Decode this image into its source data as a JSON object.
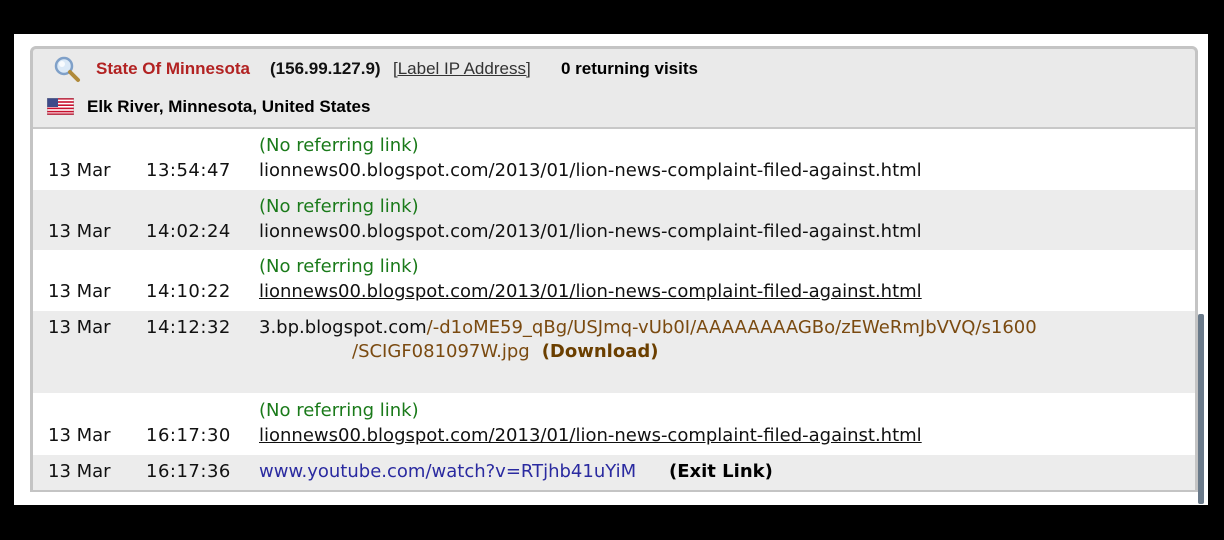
{
  "header": {
    "organization": "State Of Minnesota",
    "ip": "(156.99.127.9)",
    "label_ip": "[Label IP Address]",
    "returning": "0 returning visits",
    "location": "Elk River, Minnesota, United States"
  },
  "rows": [
    {
      "date": "13 Mar",
      "time": "13:54:47",
      "referrer": "(No referring link)",
      "url": "lionnews00.blogspot.com/2013/01/lion-news-complaint-filed-against.html"
    },
    {
      "date": "13 Mar",
      "time": "14:02:24",
      "referrer": "(No referring link)",
      "url": "lionnews00.blogspot.com/2013/01/lion-news-complaint-filed-against.html"
    },
    {
      "date": "13 Mar",
      "time": "14:10:22",
      "referrer": "(No referring link)",
      "url": "lionnews00.blogspot.com/2013/01/lion-news-complaint-filed-against.html"
    },
    {
      "date": "13 Mar",
      "time": "14:12:32",
      "url_host": "3.bp.blogspot.com",
      "url_path1": "/-d1oME59_qBg/USJmq-vUb0I/AAAAAAAAGBo/zEWeRmJbVVQ/s1600",
      "url_path2": "/SCIGF081097W.jpg",
      "download_label": "(Download)"
    },
    {
      "date": "13 Mar",
      "time": "16:17:30",
      "referrer": "(No referring link)",
      "url": "lionnews00.blogspot.com/2013/01/lion-news-complaint-filed-against.html"
    },
    {
      "date": "13 Mar",
      "time": "16:17:36",
      "url": "www.youtube.com/watch?v=RTjhb41uYiM",
      "exit_label": "(Exit Link)"
    }
  ],
  "icons": {
    "search": "search-icon",
    "flag": "us-flag-icon"
  },
  "colors": {
    "organization": "#b22222",
    "referrer": "#1a7a1a",
    "download": "#7a4a10",
    "exit_url": "#2a2aa0"
  }
}
